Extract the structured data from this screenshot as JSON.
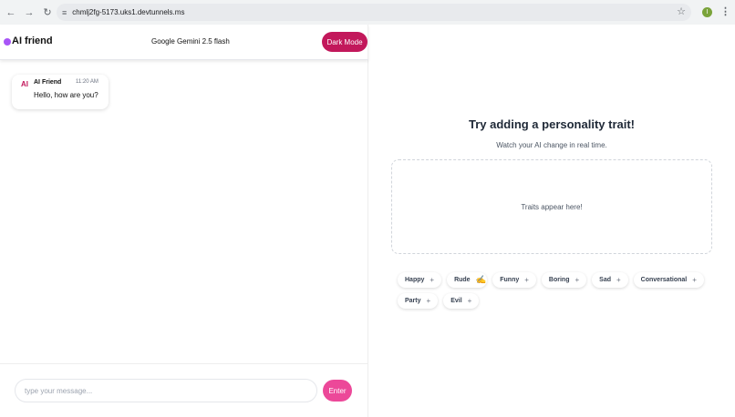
{
  "browser": {
    "url": "chmlj2fg-5173.uks1.devtunnels.ms",
    "profile_initial": "I",
    "back_icon": "arrow-left-icon",
    "forward_icon": "arrow-right-icon",
    "reload_icon": "reload-icon"
  },
  "header": {
    "app_name": "AI friend",
    "model": "Google Gemini 2.5 flash",
    "dark_mode_label": "Dark Mode",
    "accent": "#c2185b",
    "logo_color": "#a855f7"
  },
  "chat": {
    "messages": [
      {
        "avatar": "AI",
        "sender": "AI Friend",
        "time": "11:20 AM",
        "text": "Hello, how are you?"
      }
    ],
    "input_placeholder": "type your message...",
    "input_value": "",
    "send_label": "Enter",
    "send_color": "#ec4899"
  },
  "traits_panel": {
    "title": "Try adding a personality trait!",
    "subtitle": "Watch your AI change in real time.",
    "drop_zone_text": "Traits appear here!",
    "traits": [
      {
        "label": "Happy",
        "plus": "+"
      },
      {
        "label": "Rude",
        "plus": "+"
      },
      {
        "label": "Funny",
        "plus": "+"
      },
      {
        "label": "Boring",
        "plus": "+"
      },
      {
        "label": "Sad",
        "plus": "+"
      },
      {
        "label": "Conversational",
        "plus": "+"
      },
      {
        "label": "Party",
        "plus": "+"
      },
      {
        "label": "Evil",
        "plus": "+"
      }
    ]
  }
}
